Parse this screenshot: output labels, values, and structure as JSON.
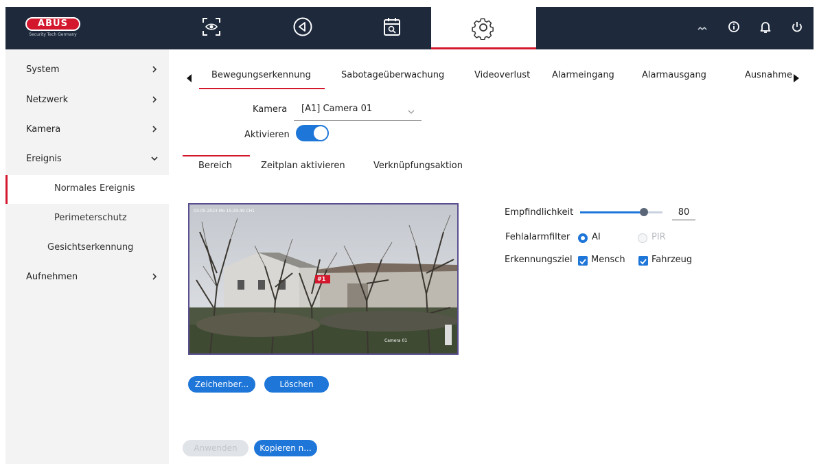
{
  "brand": {
    "name": "ABUS",
    "tagline": "Security Tech Germany"
  },
  "topbar": {
    "nav": [
      {
        "name": "live-view",
        "icon": "eye-icon"
      },
      {
        "name": "playback",
        "icon": "play-back-icon"
      },
      {
        "name": "search",
        "icon": "calendar-search-icon"
      },
      {
        "name": "settings",
        "icon": "gear-icon",
        "active": true
      }
    ],
    "right": [
      {
        "name": "network-status",
        "icon": "network-icon"
      },
      {
        "name": "info",
        "icon": "info-icon"
      },
      {
        "name": "notifications",
        "icon": "bell-icon"
      },
      {
        "name": "power",
        "icon": "power-icon"
      }
    ]
  },
  "sidebar": {
    "items": [
      {
        "label": "System",
        "chevron": "right"
      },
      {
        "label": "Netzwerk",
        "chevron": "right"
      },
      {
        "label": "Kamera",
        "chevron": "right"
      },
      {
        "label": "Ereignis",
        "chevron": "down"
      }
    ],
    "subitems": [
      {
        "label": "Normales Ereignis",
        "active": true
      },
      {
        "label": "Perimeterschutz"
      },
      {
        "label": "Gesichtserkennung"
      }
    ],
    "bottom": {
      "label": "Aufnehmen",
      "chevron": "right"
    }
  },
  "tabs": [
    {
      "label": "Bewegungserkennung",
      "active": true
    },
    {
      "label": "Sabotageüberwachung"
    },
    {
      "label": "Videoverlust"
    },
    {
      "label": "Alarmeingang"
    },
    {
      "label": "Alarmausgang"
    },
    {
      "label": "Ausnahme"
    }
  ],
  "form": {
    "camera_label": "Kamera",
    "camera_value": "[A1] Camera 01",
    "enable_label": "Aktivieren",
    "enable_on": true
  },
  "subtabs": [
    {
      "label": "Bereich",
      "active": true
    },
    {
      "label": "Zeitplan aktivieren"
    },
    {
      "label": "Verknüpfungsaktion"
    }
  ],
  "video": {
    "osd_datetime": "03-05-2023 Mo 15:29:49 CH1",
    "osd_channel": "Camera 01",
    "zone_label": "#1"
  },
  "settings": {
    "sensitivity_label": "Empfindlichkeit",
    "sensitivity_value": "80",
    "sensitivity_level": 80,
    "filter_label": "Fehlalarmfilter",
    "filter_ai": "AI",
    "filter_pir": "PIR",
    "target_label": "Erkennungsziel",
    "target_person": "Mensch",
    "target_vehicle": "Fahrzeug"
  },
  "buttons": {
    "draw": "Zeichenber...",
    "clear": "Löschen",
    "apply": "Anwenden",
    "copy": "Kopieren n..."
  },
  "colors": {
    "accent": "#1e76d8",
    "brand_red": "#d3172d",
    "topbar": "#1e2a3c"
  }
}
